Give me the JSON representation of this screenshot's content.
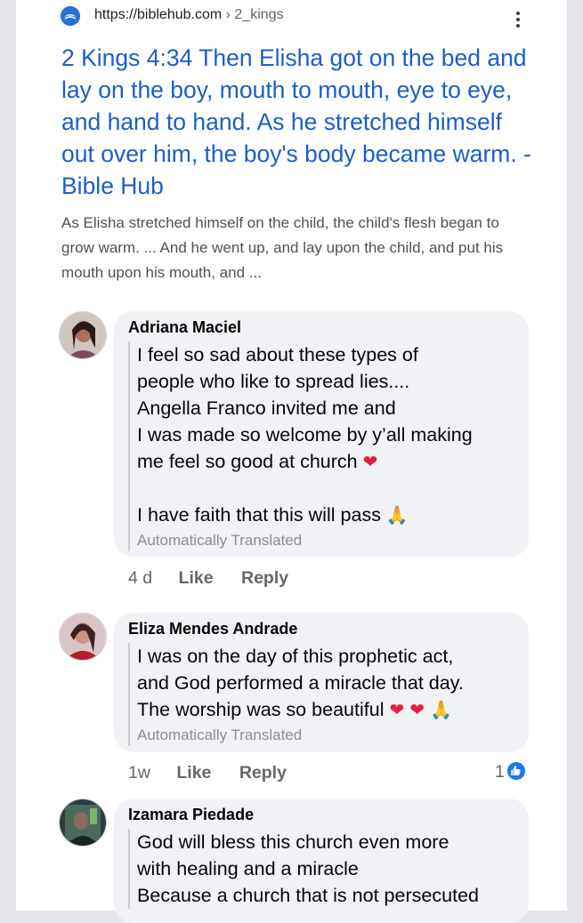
{
  "result": {
    "url_domain": "https://biblehub.com",
    "url_sep": " › ",
    "url_path": "2_kings",
    "site_icon": "biblehub-logo-icon",
    "title": "2 Kings 4:34 Then Elisha got on the bed and lay on the boy, mouth to mouth, eye to eye, and hand to hand. As he stretched himself out over him, the boy's body became warm. - Bible Hub",
    "snippet": "As Elisha stretched himself on the child, the child's flesh began to grow warm. ... And he went up, and lay upon the child, and put his mouth upon his mouth, and ..."
  },
  "comments": [
    {
      "name": "Adriana Maciel",
      "lines": [
        "I feel so sad about these types of",
        "people who like to spread lies....",
        "Angella Franco invited me and",
        "I was made so welcome by y’all making",
        "me feel so good at church ❤️",
        "",
        "I have faith that this will pass 🙏"
      ],
      "translated": "Automatically Translated",
      "time": "4 d",
      "like": "Like",
      "reply": "Reply"
    },
    {
      "name": "Eliza Mendes Andrade",
      "lines": [
        "I was on the day of this prophetic act,",
        "and God performed a miracle that day.",
        "The worship was so beautiful ❤️ ❤️ 🙏"
      ],
      "translated": "Automatically Translated",
      "time": "1w",
      "like": "Like",
      "reply": "Reply",
      "reactions": "1"
    },
    {
      "name": "Izamara Piedade",
      "lines": [
        "God will bless this church even more",
        "with healing and a miracle",
        "Because a church that is not persecuted"
      ]
    }
  ],
  "colors": {
    "link_title": "#1a5fc8",
    "bubble": "#f0f2f5",
    "like_badge": "#1877f2",
    "heart": "#e41e3f"
  }
}
